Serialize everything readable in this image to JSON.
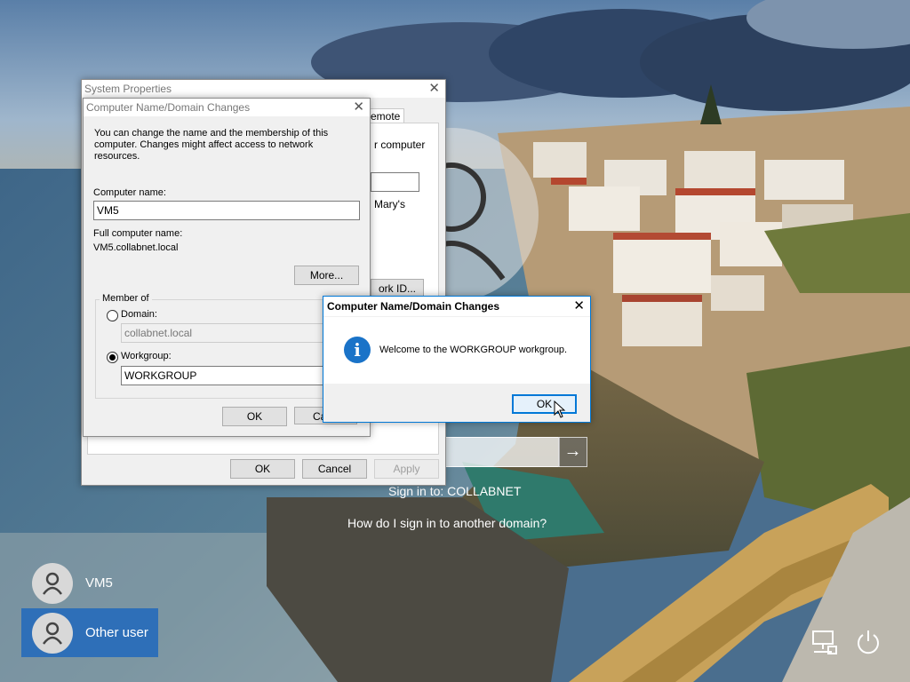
{
  "system_properties": {
    "title": "System Properties",
    "tab_remote": "emote",
    "partial_computer": "r computer",
    "partial_marys": "Mary's",
    "partial_network_id": "ork ID...",
    "ok_label": "OK",
    "cancel_label": "Cancel",
    "apply_label": "Apply"
  },
  "name_changes": {
    "title": "Computer Name/Domain Changes",
    "description": "You can change the name and the membership of this computer. Changes might affect access to network resources.",
    "computer_name_label": "Computer name:",
    "computer_name_value": "VM5",
    "full_name_label": "Full computer name:",
    "full_name_value": "VM5.collabnet.local",
    "more_label": "More...",
    "member_of_label": "Member of",
    "domain_label": "Domain:",
    "domain_value": "collabnet.local",
    "workgroup_label": "Workgroup:",
    "workgroup_value": "WORKGROUP",
    "ok_label": "OK",
    "cancel_label": "Ca"
  },
  "welcome_dialog": {
    "title": "Computer Name/Domain Changes",
    "message": "Welcome to the WORKGROUP workgroup.",
    "ok_label": "OK",
    "icon": "info-icon"
  },
  "lock_screen": {
    "sign_in_to": "Sign in to: COLLABNET",
    "other_domain_link": "How do I sign in to another domain?",
    "users": [
      {
        "name": "VM5",
        "selected": false
      },
      {
        "name": "Other user",
        "selected": true
      }
    ],
    "tray_icons": [
      "network-icon",
      "power-icon"
    ]
  },
  "colors": {
    "accent": "#0078d7",
    "selected_user": "#2e6fb8",
    "info_icon": "#1a73c8"
  }
}
